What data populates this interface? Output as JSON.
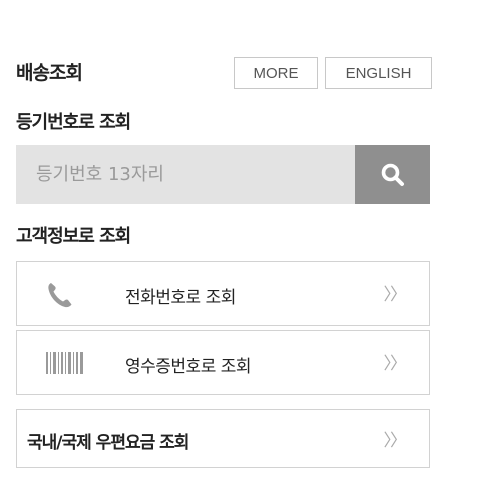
{
  "header": {
    "title": "배송조회",
    "more_label": "MORE",
    "english_label": "ENGLISH"
  },
  "registered_lookup": {
    "title": "등기번호로 조회",
    "placeholder": "등기번호 13자리",
    "search_icon": "search-icon"
  },
  "customer_lookup": {
    "title": "고객정보로 조회",
    "phone": {
      "icon": "phone-icon",
      "label": "전화번호로 조회",
      "arrow": "〉〉"
    },
    "receipt": {
      "icon": "barcode-icon",
      "label": "영수증번호로 조회",
      "arrow": "〉〉"
    }
  },
  "postage": {
    "label": "국내/국제 우편요금 조회",
    "arrow": "〉〉"
  },
  "colors": {
    "search_bg": "#e3e3e3",
    "search_button": "#8f8f8f",
    "border": "#d2d2d2",
    "icon_gray": "#9a9a9a"
  }
}
